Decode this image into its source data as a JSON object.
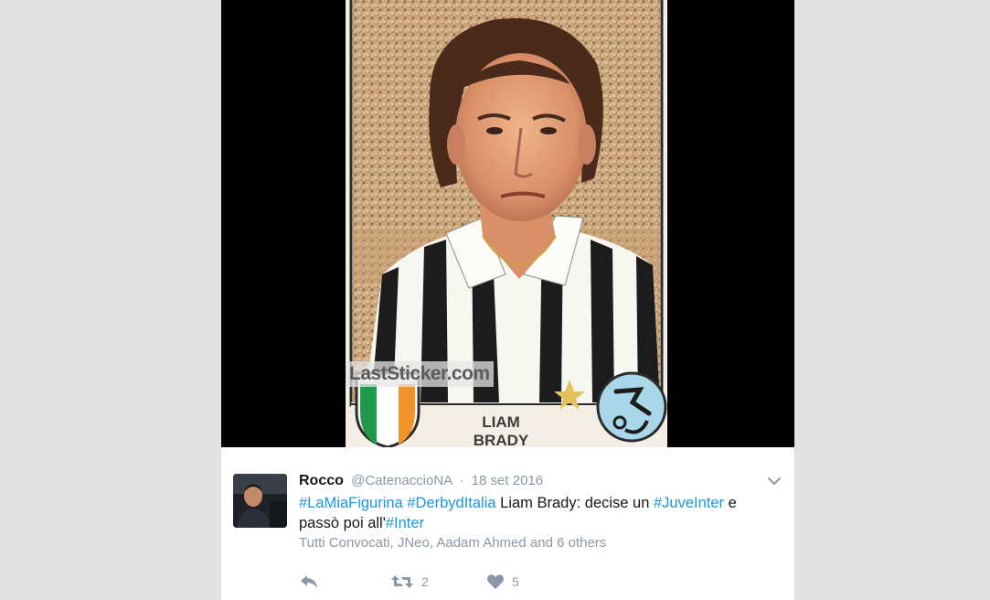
{
  "media": {
    "watermark": "LastSticker.com",
    "player_first_name": "LIAM",
    "player_last_name": "BRADY"
  },
  "tweet": {
    "author_name": "Rocco",
    "handle": "@CatenaccioNA",
    "separator": "·",
    "date": "18 set 2016",
    "text": {
      "hashtag_1": "#LaMiaFigurina",
      "hashtag_2": "#DerbydItalia",
      "plain_1": " Liam Brady: decise un ",
      "hashtag_3": "#JuveInter",
      "plain_2": " e passò poi all'",
      "hashtag_4": "#Inter"
    },
    "social_context": "Tutti Convocati, JNeo, Aadam Ahmed and 6 others",
    "retweet_count": "2",
    "like_count": "5",
    "icons": {
      "reply": "reply-icon",
      "retweet": "retweet-icon",
      "like": "heart-icon",
      "more": "chevron-down-icon"
    }
  },
  "colors": {
    "hashtag": "#1b95e0",
    "muted": "#8b98a5",
    "text": "#14171a",
    "page_background": "#e1e1e1"
  }
}
